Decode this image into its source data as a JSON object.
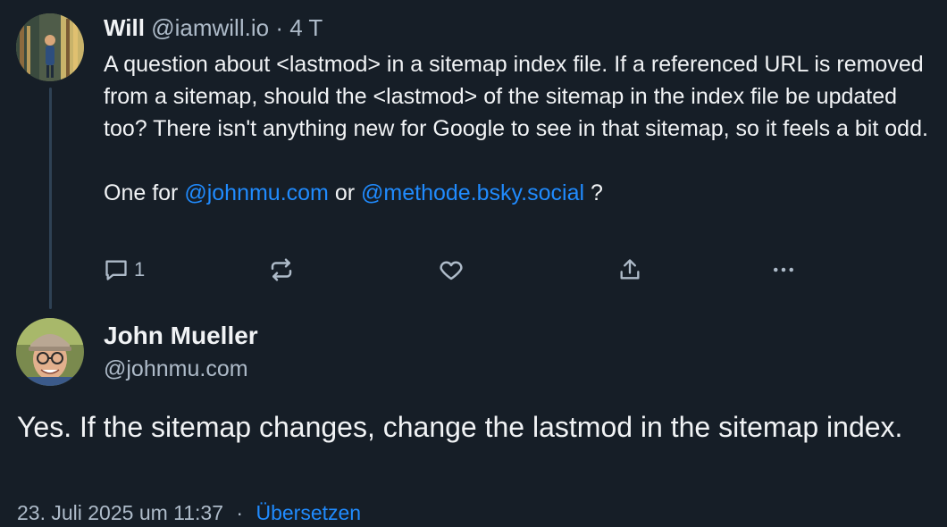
{
  "parent_post": {
    "author_name": "Will",
    "handle": "@iamwill.io",
    "separator": "·",
    "time_ago": "4 T",
    "text_line1_part1": "A question about <lastmod> in a sitemap index file. If a referenced URL is removed from a sitemap, should the <lastmod> of the sitemap in the index file be updated too? There isn't anything new for Google to see in that sitemap, so it feels a bit odd.",
    "text_line2_prefix": "One for ",
    "mention1": "@johnmu.com",
    "text_line2_mid": " or ",
    "mention2": "@methode.bsky.social",
    "text_line2_suffix": " ?",
    "reply_count": "1",
    "avatar_icon": "user-photo-avatar",
    "icons": {
      "reply": "speech-bubble-icon",
      "repost": "repost-arrows-icon",
      "like": "heart-icon",
      "share": "share-upload-icon",
      "more": "more-dots-icon"
    }
  },
  "reply_post": {
    "author_name": "John Mueller",
    "handle": "@johnmu.com",
    "text": "Yes. If the sitemap changes, change the lastmod in the sitemap index.",
    "timestamp": "23. Juli 2025 um 11:37",
    "separator": "·",
    "translate_label": "Übersetzen",
    "avatar_icon": "user-photo-avatar"
  },
  "colors": {
    "background": "#161e27",
    "text": "#f1f3f5",
    "muted": "#aebbc9",
    "link": "#208bfe",
    "thread_line": "#2e4154"
  }
}
